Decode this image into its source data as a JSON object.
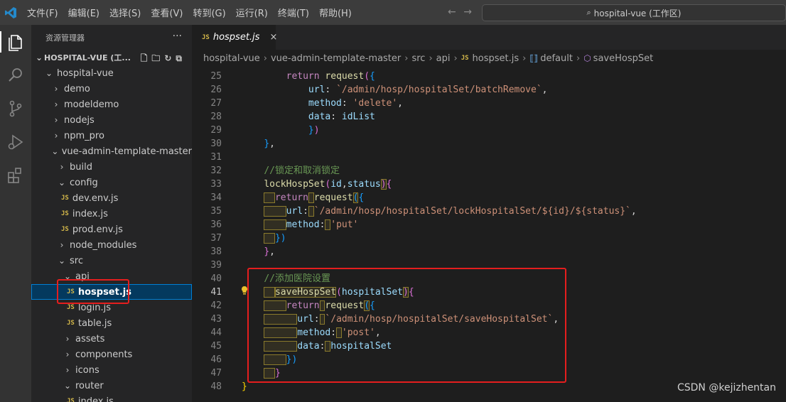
{
  "menu": [
    "文件(F)",
    "编辑(E)",
    "选择(S)",
    "查看(V)",
    "转到(G)",
    "运行(R)",
    "终端(T)",
    "帮助(H)"
  ],
  "nav": {
    "back": "←",
    "forward": "→"
  },
  "search": {
    "icon": "search-icon",
    "label": "hospital-vue (工作区)"
  },
  "explorer": {
    "title": "资源管理器",
    "more": "···",
    "root": "HOSPITAL-VUE (工...",
    "items": [
      {
        "label": "hospital-vue",
        "type": "folder",
        "open": true
      },
      {
        "label": "demo",
        "type": "folder"
      },
      {
        "label": "modeldemo",
        "type": "folder"
      },
      {
        "label": "nodejs",
        "type": "folder"
      },
      {
        "label": "npm_pro",
        "type": "folder"
      },
      {
        "label": "vue-admin-template-master",
        "type": "folder",
        "open": true
      },
      {
        "label": "build",
        "type": "folder"
      },
      {
        "label": "config",
        "type": "folder",
        "open": true
      },
      {
        "label": "dev.env.js",
        "type": "js"
      },
      {
        "label": "index.js",
        "type": "js"
      },
      {
        "label": "prod.env.js",
        "type": "js"
      },
      {
        "label": "node_modules",
        "type": "folder"
      },
      {
        "label": "src",
        "type": "folder",
        "open": true
      },
      {
        "label": "api",
        "type": "folder",
        "open": true
      },
      {
        "label": "hospset.js",
        "type": "js",
        "selected": true
      },
      {
        "label": "login.js",
        "type": "js"
      },
      {
        "label": "table.js",
        "type": "js"
      },
      {
        "label": "assets",
        "type": "folder"
      },
      {
        "label": "components",
        "type": "folder"
      },
      {
        "label": "icons",
        "type": "folder"
      },
      {
        "label": "router",
        "type": "folder",
        "open": true
      },
      {
        "label": "index.js",
        "type": "js"
      }
    ]
  },
  "tab": {
    "badge": "JS",
    "name": "hospset.js",
    "close": "×"
  },
  "breadcrumb": [
    "hospital-vue",
    "vue-admin-template-master",
    "src",
    "api",
    "hospset.js",
    "default",
    "saveHospSet"
  ],
  "code": {
    "lines": [
      "25",
      "26",
      "27",
      "28",
      "29",
      "30",
      "31",
      "32",
      "33",
      "34",
      "35",
      "36",
      "37",
      "38",
      "39",
      "40",
      "41",
      "42",
      "43",
      "44",
      "45",
      "46",
      "47",
      "48"
    ],
    "current_line": "41",
    "comment_lock": "//锁定和取消锁定",
    "comment_add": "//添加医院设置",
    "url_batch": "`/admin/hosp/hospitalSet/batchRemove`",
    "url_lock": "`/admin/hosp/hospitalSet/lockHospitalSet/${id}/${status}`",
    "url_save": "`/admin/hosp/hospitalSet/saveHospitalSet`",
    "fn_lock": "lockHospSet",
    "fn_save": "saveHospSet"
  },
  "watermark": "CSDN @kejizhentan",
  "colors": {
    "accent": "#007fd4",
    "highlight_box": "#e51e1e",
    "js_badge": "#d5b94a"
  }
}
